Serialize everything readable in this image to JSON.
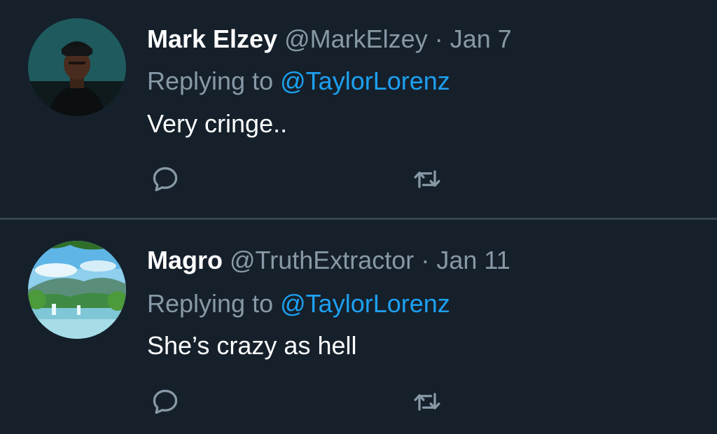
{
  "colors": {
    "background": "#15202b",
    "divider": "#38444d",
    "secondary_text": "#8899a6",
    "link": "#1da1f2",
    "primary_text": "#ffffff"
  },
  "tweets": [
    {
      "name": "Mark Elzey",
      "handle": "@MarkElzey",
      "separator": "·",
      "date": "Jan 7",
      "replying_prefix": "Replying to",
      "replying_to": "@TaylorLorenz",
      "text": "Very cringe..",
      "avatar": "portrait-photo",
      "actions": [
        "reply-icon",
        "retweet-icon"
      ]
    },
    {
      "name": "Magro",
      "handle": "@TruthExtractor",
      "separator": "·",
      "date": "Jan 11",
      "replying_prefix": "Replying to",
      "replying_to": "@TaylorLorenz",
      "text": "She’s crazy as hell",
      "avatar": "landscape-photo",
      "actions": [
        "reply-icon",
        "retweet-icon"
      ]
    }
  ]
}
